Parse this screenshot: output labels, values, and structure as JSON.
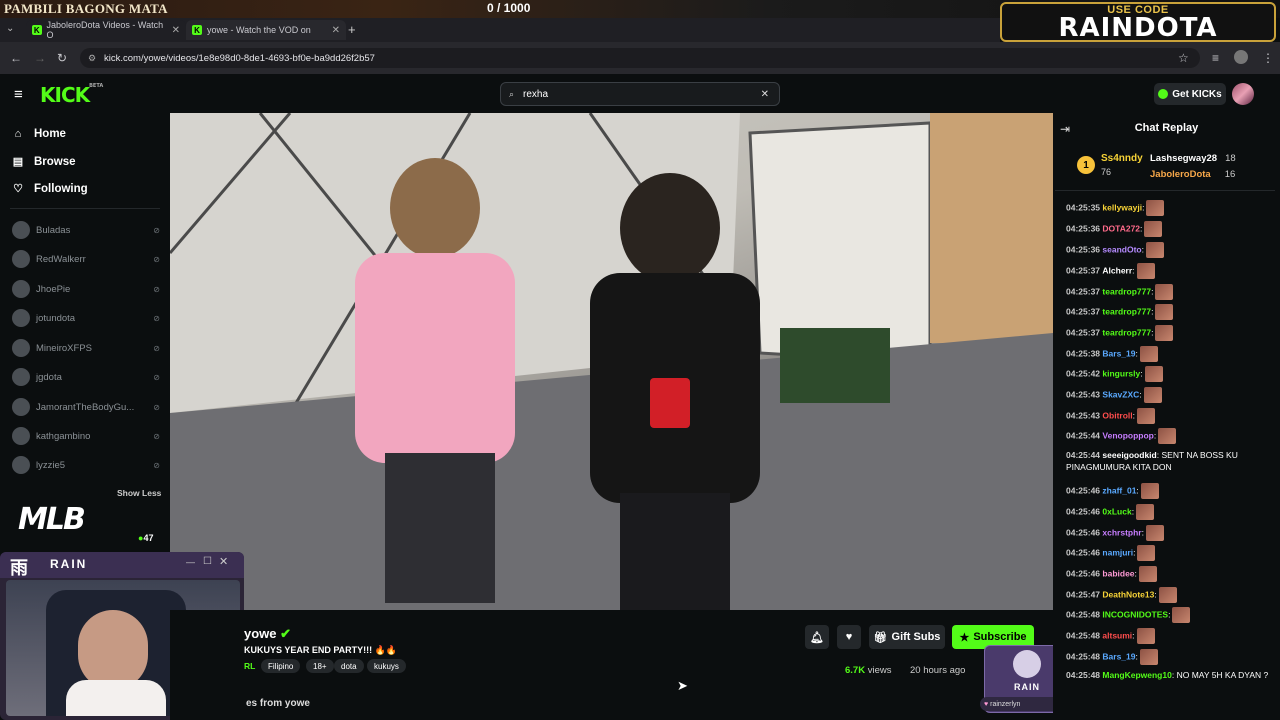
{
  "overlay": {
    "left_text": "PAMBILI BAGONG MATA",
    "counter": "0  / 1000",
    "promo_small": "USE CODE",
    "promo_big": "RAINDOTA"
  },
  "tabs": [
    {
      "title": "JaboleroDota Videos - Watch O"
    },
    {
      "title": "yowe - Watch the VOD on"
    }
  ],
  "url": "kick.com/yowe/videos/1e8e98d0-8de1-4693-bf0e-ba9dd26f2b57",
  "header": {
    "logo": "KICK",
    "logo_badge": "BETA",
    "search_value": "rexha",
    "get_kicks": "Get KICKs"
  },
  "sidebar": {
    "nav": [
      {
        "label": "Home"
      },
      {
        "label": "Browse"
      },
      {
        "label": "Following"
      }
    ],
    "channels": [
      "Buladas",
      "RedWalkerr",
      "JhoePie",
      "jotundota",
      "MineiroXFPS",
      "jgdota",
      "JamorantTheBodyGu...",
      "kathgambino",
      "lyzzie5"
    ],
    "show_less": "Show Less",
    "mlb_count": "47",
    "mlb_logo": "MLB"
  },
  "webcam": {
    "brand": "RAIN"
  },
  "video_info": {
    "streamer": "yowe",
    "title": "KUKUYS YEAR END PARTY!!!",
    "title_emoji": "🔥🔥",
    "lang_prefix": "RL",
    "tags": [
      "Filipino",
      "18+",
      "dota",
      "kukuys"
    ],
    "views": "6.7K",
    "views_label": "views",
    "ago": "20 hours ago",
    "gift_subs": "Gift Subs",
    "subscribe": "Subscribe",
    "bottom_text": "es from yowe"
  },
  "rain_badge": {
    "name": "rainzerlyn",
    "brand": "RAIN"
  },
  "chat": {
    "title": "Chat Replay",
    "leaderboard": [
      {
        "rank": "1",
        "name": "Ss4nndy",
        "count": "76"
      },
      {
        "name": "Lashsegway28",
        "count": "18"
      },
      {
        "name": "JaboleroDota",
        "count": "16"
      }
    ],
    "messages": [
      {
        "ts": "04:25:35",
        "user": "kellywayji",
        "color": "#f7d337",
        "text": ""
      },
      {
        "ts": "04:25:36",
        "user": "DOTA272",
        "color": "#ff6b8b",
        "text": ""
      },
      {
        "ts": "04:25:36",
        "user": "seandOto",
        "color": "#b58bff",
        "text": ""
      },
      {
        "ts": "04:25:37",
        "user": "Alcherr",
        "color": "#ffffff",
        "text": ""
      },
      {
        "ts": "04:25:37",
        "user": "teardrop777",
        "color": "#53fc18",
        "text": ""
      },
      {
        "ts": "04:25:37",
        "user": "teardrop777",
        "color": "#53fc18",
        "text": ""
      },
      {
        "ts": "04:25:37",
        "user": "teardrop777",
        "color": "#53fc18",
        "text": ""
      },
      {
        "ts": "04:25:38",
        "user": "Bars_19",
        "color": "#5aa9ff",
        "text": ""
      },
      {
        "ts": "04:25:42",
        "user": "kingursly",
        "color": "#53fc18",
        "text": ""
      },
      {
        "ts": "04:25:43",
        "user": "SkavZXC",
        "color": "#5aa9ff",
        "text": ""
      },
      {
        "ts": "04:25:43",
        "user": "Obitroll",
        "color": "#ff4d4d",
        "text": ""
      },
      {
        "ts": "04:25:44",
        "user": "Venopoppop",
        "color": "#c77dff",
        "text": ""
      },
      {
        "ts": "04:25:44",
        "user": "seeeigoodkid",
        "color": "#ffffff",
        "text": "SENT NA BOSS KU PINAGMUMURA KITA DON"
      },
      {
        "ts": "04:25:46",
        "user": "zhaff_01",
        "color": "#5aa9ff",
        "text": ""
      },
      {
        "ts": "04:25:46",
        "user": "0xLuck",
        "color": "#53fc18",
        "text": ""
      },
      {
        "ts": "04:25:46",
        "user": "xchrstphr",
        "color": "#c77dff",
        "text": ""
      },
      {
        "ts": "04:25:46",
        "user": "namjuri",
        "color": "#5aa9ff",
        "text": ""
      },
      {
        "ts": "04:25:46",
        "user": "babidee",
        "color": "#ff9ad5",
        "text": ""
      },
      {
        "ts": "04:25:47",
        "user": "DeathNote13",
        "color": "#f7d337",
        "text": ""
      },
      {
        "ts": "04:25:48",
        "user": "INCOGNIDOTES",
        "color": "#53fc18",
        "text": ""
      },
      {
        "ts": "04:25:48",
        "user": "altsumi",
        "color": "#ff4d4d",
        "text": ""
      },
      {
        "ts": "04:25:48",
        "user": "Bars_19",
        "color": "#5aa9ff",
        "text": ""
      },
      {
        "ts": "04:25:48",
        "user": "MangKepweng10",
        "color": "#53fc18",
        "text": "NO MAY 5H KA DYAN ?"
      }
    ]
  },
  "colors": {
    "kick_green": "#53fc18",
    "bg": "#0b0e0f",
    "panel": "#24282b"
  }
}
